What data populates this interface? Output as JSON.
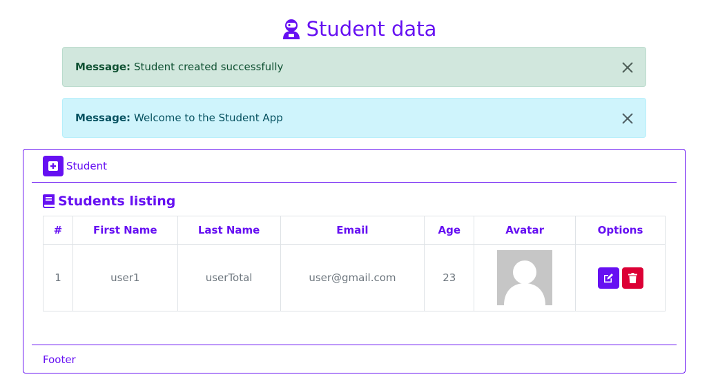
{
  "header": {
    "title": "Student data",
    "icon": "astronaut-icon"
  },
  "alerts": [
    {
      "label": "Message:",
      "text": "Student created successfully",
      "variant": "success"
    },
    {
      "label": "Message:",
      "text": "Welcome to the Student App",
      "variant": "info"
    }
  ],
  "card": {
    "header_label": "Student",
    "section_title": "Students listing",
    "footer": "Footer"
  },
  "table": {
    "columns": [
      "#",
      "First Name",
      "Last Name",
      "Email",
      "Age",
      "Avatar",
      "Options"
    ],
    "rows": [
      {
        "index": "1",
        "first_name": "user1",
        "last_name": "userTotal",
        "email": "user@gmail.com",
        "age": "23",
        "avatar": "default-avatar"
      }
    ]
  },
  "colors": {
    "primary": "#6610f2",
    "danger": "#dc0035",
    "success_bg": "#d1e7dd",
    "info_bg": "#cff4fc"
  }
}
